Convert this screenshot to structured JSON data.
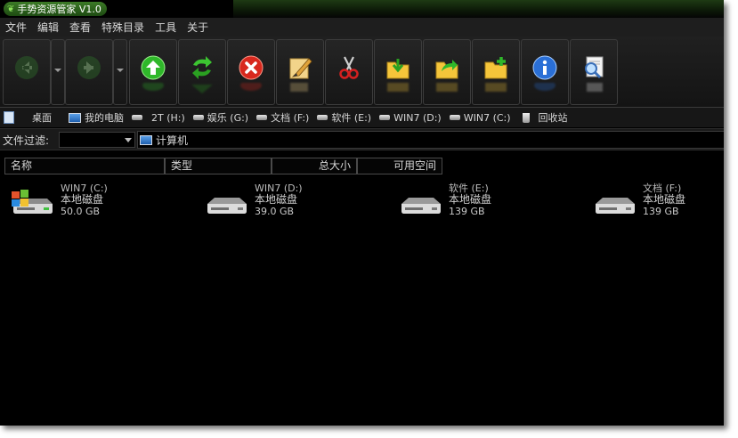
{
  "app": {
    "title": "手势资源管家 V1.0"
  },
  "menu": [
    "文件",
    "编辑",
    "查看",
    "特殊目录",
    "工具",
    "关于"
  ],
  "toolbar": {
    "buttons": [
      {
        "icon": "back-icon"
      },
      {
        "icon": "forward-icon"
      },
      {
        "icon": "up-icon"
      },
      {
        "icon": "refresh-icon"
      },
      {
        "icon": "delete-icon"
      },
      {
        "icon": "rename-icon"
      },
      {
        "icon": "cut-icon"
      },
      {
        "icon": "paste-icon"
      },
      {
        "icon": "move-icon"
      },
      {
        "icon": "new-folder-icon"
      },
      {
        "icon": "info-icon"
      },
      {
        "icon": "search-icon"
      }
    ]
  },
  "favorites": [
    "桌面",
    "我的电脑",
    "2T (H:)",
    "娱乐 (G:)",
    "文档 (F:)",
    "软件 (E:)",
    "WIN7 (D:)",
    "WIN7 (C:)",
    "回收站"
  ],
  "filter": {
    "label": "文件过滤:",
    "value": ""
  },
  "address": {
    "value": "计算机"
  },
  "columns": [
    "名称",
    "类型",
    "总大小",
    "可用空间"
  ],
  "drives": [
    {
      "name": "WIN7 (C:)",
      "type": "本地磁盘",
      "size": "50.0 GB",
      "icon": "windows-drive-icon"
    },
    {
      "name": "WIN7 (D:)",
      "type": "本地磁盘",
      "size": "39.0 GB",
      "icon": "hard-drive-icon"
    },
    {
      "name": "软件 (E:)",
      "type": "本地磁盘",
      "size": "139 GB",
      "icon": "hard-drive-icon"
    },
    {
      "name": "文档 (F:)",
      "type": "本地磁盘",
      "size": "139 GB",
      "icon": "hard-drive-icon"
    }
  ],
  "colors": {
    "accent": "#3c7a26",
    "background": "#000000",
    "text": "#d6d6d6"
  }
}
